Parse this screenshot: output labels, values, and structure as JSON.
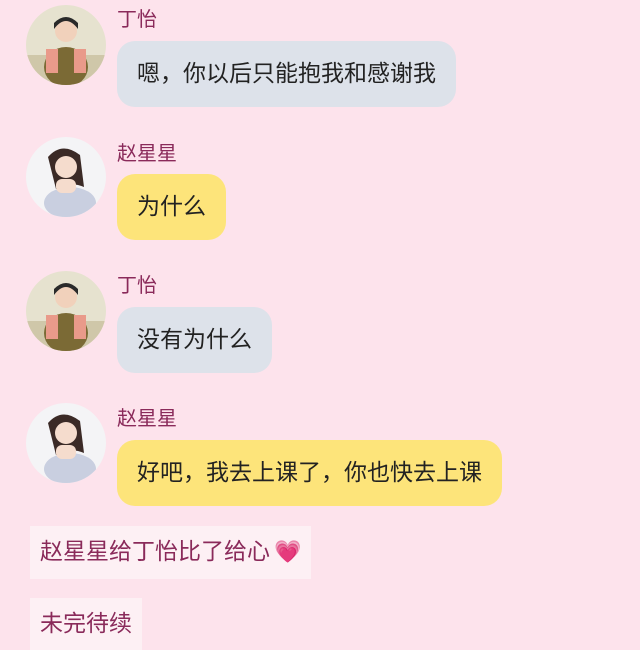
{
  "messages": [
    {
      "sender": "丁怡",
      "text": "嗯，你以后只能抱我和感谢我"
    },
    {
      "sender": "赵星星",
      "text": "为什么"
    },
    {
      "sender": "丁怡",
      "text": "没有为什么"
    },
    {
      "sender": "赵星星",
      "text": "好吧，我去上课了，你也快去上课"
    }
  ],
  "notice": "赵星星给丁怡比了给心",
  "footer_notice": "未完待续",
  "icons": {
    "heart": "heart-icon"
  },
  "colors": {
    "background": "#fde3ec",
    "sender_name": "#8a2a5a",
    "bubble_dingyi": "#dde2ea",
    "bubble_zhaoxingxing": "#fde47a",
    "notice_bg": "#fdf0f4"
  }
}
